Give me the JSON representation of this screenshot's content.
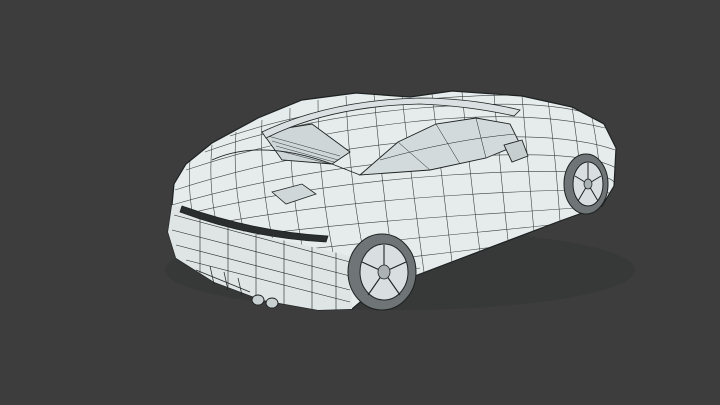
{
  "viewport": {
    "background_color": "#3d3d3d"
  },
  "model": {
    "subject": "sports-car",
    "render_style": "wireframe-over-solid",
    "surface_color": "#e6ecec",
    "wire_color": "#1e2222",
    "shadow_color": "#9aa2a3",
    "tire_color": "#6f7576"
  }
}
